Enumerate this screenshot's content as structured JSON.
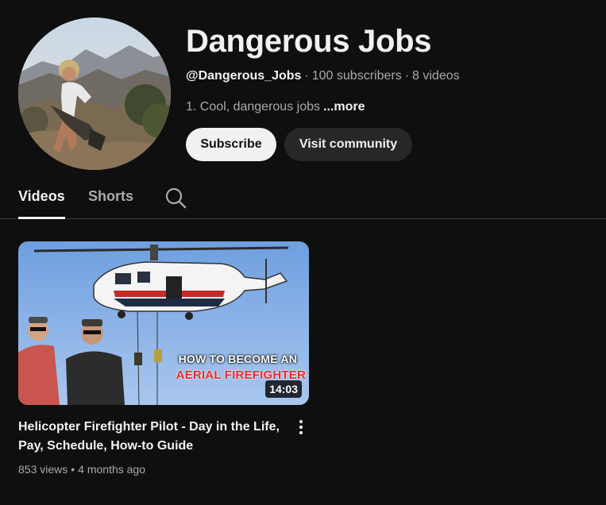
{
  "channel": {
    "title": "Dangerous Jobs",
    "handle": "@Dangerous_Jobs",
    "subscribers": "100 subscribers",
    "video_count": "8 videos",
    "meta_separator": "·",
    "description": "1. Cool, dangerous jobs",
    "more_label": "...more",
    "avatar_icon": "channel-avatar-climber"
  },
  "actions": {
    "subscribe_label": "Subscribe",
    "community_label": "Visit community"
  },
  "tabs": [
    {
      "label": "Videos",
      "selected": true
    },
    {
      "label": "Shorts",
      "selected": false
    }
  ],
  "search_icon": "search-icon",
  "videos": [
    {
      "title": "Helicopter Firefighter Pilot - Day in the Life, Pay, Schedule, How-to Guide",
      "views": "853 views",
      "age": "4 months ago",
      "duration": "14:03",
      "thumb_text_1": "HOW TO BECOME AN",
      "thumb_text_2": "AERIAL FIREFIGHTER",
      "menu_icon": "more-vert-icon"
    }
  ],
  "colors": {
    "background": "#0f0f0f",
    "text_primary": "#f1f1f1",
    "text_secondary": "#aaaaaa",
    "subscribe_bg": "#f1f1f1",
    "community_bg": "#272727",
    "thumb_accent_red": "#e62b2b"
  }
}
